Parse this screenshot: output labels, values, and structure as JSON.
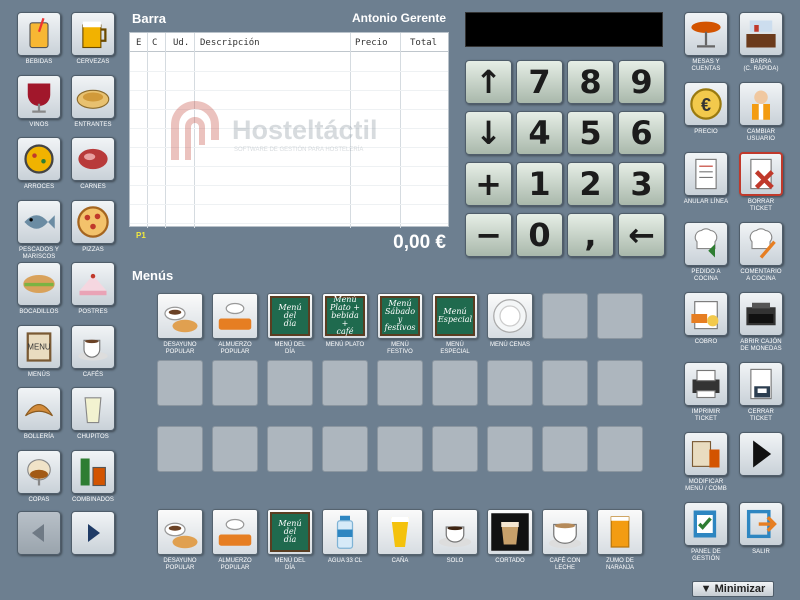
{
  "sidebar_left": [
    {
      "label": "BEBIDAS",
      "icon": "drink-glass-icon"
    },
    {
      "label": "CERVEZAS",
      "icon": "beer-mug-icon"
    },
    {
      "label": "VINOS",
      "icon": "wine-glass-icon"
    },
    {
      "label": "ENTRANTES",
      "icon": "appetizer-plate-icon"
    },
    {
      "label": "ARROCES",
      "icon": "paella-icon"
    },
    {
      "label": "CARNES",
      "icon": "steak-icon"
    },
    {
      "label": "PESCADOS Y\nMARISCOS",
      "icon": "fish-icon"
    },
    {
      "label": "PIZZAS",
      "icon": "pizza-icon"
    },
    {
      "label": "BOCADILLOS",
      "icon": "sandwich-icon"
    },
    {
      "label": "POSTRES",
      "icon": "cake-icon"
    },
    {
      "label": "MENÚS",
      "icon": "menu-board-icon"
    },
    {
      "label": "CAFÉS",
      "icon": "coffee-cup-icon"
    },
    {
      "label": "BOLLERÍA",
      "icon": "croissant-icon"
    },
    {
      "label": "CHUPITOS",
      "icon": "shot-glass-icon"
    },
    {
      "label": "COPAS",
      "icon": "brandy-glass-icon"
    },
    {
      "label": "COMBINADOS",
      "icon": "mixed-drinks-icon"
    }
  ],
  "sidebar_right": [
    {
      "label": "MESAS Y\nCUENTAS",
      "icon": "table-icon"
    },
    {
      "label": "BARRA\n(C. RÁPIDA)",
      "icon": "bar-counter-icon"
    },
    {
      "label": "PRECIO",
      "icon": "euro-icon"
    },
    {
      "label": "CAMBIAR\nUSUARIO",
      "icon": "waiter-icon"
    },
    {
      "label": "ANULAR LÍNEA",
      "icon": "cancel-line-icon"
    },
    {
      "label": "BORRAR\nTICKET",
      "icon": "delete-ticket-icon"
    },
    {
      "label": "PEDIDO A\nCOCINA",
      "icon": "chef-hat-order-icon"
    },
    {
      "label": "COMENTARIO\nA COCINA",
      "icon": "chef-hat-comment-icon"
    },
    {
      "label": "COBRO",
      "icon": "payment-icon"
    },
    {
      "label": "ABRIR CAJÓN\nDE MONEDAS",
      "icon": "cash-drawer-icon"
    },
    {
      "label": "IMPRIMIR\nTICKET",
      "icon": "printer-icon"
    },
    {
      "label": "CERRAR\nTICKET",
      "icon": "close-ticket-icon"
    },
    {
      "label": "MODIFICAR\nMENÚ / COMB",
      "icon": "modify-menu-icon"
    },
    {
      "label": "",
      "icon": "next-page-icon"
    },
    {
      "label": "PANEL DE\nGESTIÓN",
      "icon": "management-panel-icon"
    },
    {
      "label": "SALIR",
      "icon": "exit-icon"
    }
  ],
  "ticket": {
    "title": "Barra",
    "user": "Antonio Gerente",
    "columns": [
      "E",
      "C",
      "Ud.",
      "Descripción",
      "Precio",
      "Total"
    ],
    "page_tag": "P1",
    "total": "0,00 €"
  },
  "watermark": {
    "name": "Hosteltáctil",
    "tagline": "SOFTWARE DE GESTIÓN PARA HOSTELERÍA"
  },
  "keypad": [
    "↑",
    "7",
    "8",
    "9",
    "↓",
    "4",
    "5",
    "6",
    "+",
    "1",
    "2",
    "3",
    "−",
    "0",
    ",",
    "←"
  ],
  "menus_section": {
    "title": "Menús",
    "row1": [
      {
        "label": "DESAYUNO\nPOPULAR",
        "icon": "breakfast-icon"
      },
      {
        "label": "ALMUERZO\nPOPULAR",
        "icon": "lunch-icon"
      },
      {
        "label": "MENÚ DEL\nDÍA",
        "board": "Menú\ndel\ndía"
      },
      {
        "label": "MENÚ PLATO",
        "board": "Menú\nPlato +\nbebida +\ncafé"
      },
      {
        "label": "MENÚ\nFESTIVO",
        "board": "Menú\nSábado\ny\nfestivos"
      },
      {
        "label": "MENÚ\nESPECIAL",
        "board": "Menú\nEspecial"
      },
      {
        "label": "MENÚ CENAS",
        "icon": "empty-plate-icon"
      }
    ],
    "row4": [
      {
        "label": "DESAYUNO\nPOPULAR",
        "icon": "breakfast-icon"
      },
      {
        "label": "ALMUERZO\nPOPULAR",
        "icon": "lunch-icon"
      },
      {
        "label": "MENÚ DEL\nDÍA",
        "board": "Menú\ndel\ndía"
      },
      {
        "label": "AGUA 33 CL",
        "icon": "water-bottle-icon"
      },
      {
        "label": "CAÑA",
        "icon": "beer-glass-icon"
      },
      {
        "label": "SOLO",
        "icon": "espresso-icon"
      },
      {
        "label": "CORTADO",
        "icon": "cortado-icon"
      },
      {
        "label": "CAFÉ CON\nLECHE",
        "icon": "coffee-milk-icon"
      },
      {
        "label": "ZUMO DE\nNARANJA",
        "icon": "orange-juice-icon"
      }
    ]
  },
  "minimize_label": "▼ Minimizar"
}
